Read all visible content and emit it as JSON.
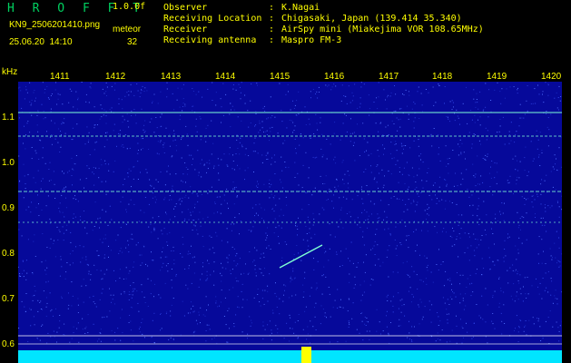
{
  "header": {
    "app_name": "H R O F F T",
    "version": "1.0.0f",
    "filename": "KN9_2506201410.png",
    "datetime": "25.06.20  14:10",
    "meteor_label": "meteor",
    "meteor_count": "32",
    "info": [
      {
        "key": "Observer",
        "value": "K.Nagai"
      },
      {
        "key": "Receiving Location",
        "value": "Chigasaki, Japan (139.414 35.340)"
      },
      {
        "key": "Receiver",
        "value": "AirSpy mini (Miakejima VOR 108.65MHz)"
      },
      {
        "key": "Receiving antenna",
        "value": "Maspro FM-3"
      }
    ]
  },
  "axis": {
    "y_unit": "kHz",
    "y_ticks": [
      "1.1",
      "1.0",
      "0.9",
      "0.8",
      "0.7",
      "0.6"
    ],
    "x_ticks": [
      "1411",
      "1412",
      "1413",
      "1414",
      "1415",
      "1416",
      "1417",
      "1418",
      "1419",
      "1420"
    ]
  },
  "colors": {
    "background": "#000000",
    "plot_background": "#06099a",
    "text": "#ffff00",
    "title": "#00d060",
    "signal": "#7fffd4",
    "baseline": "#00e5ff",
    "echo": "#ffff00"
  }
}
